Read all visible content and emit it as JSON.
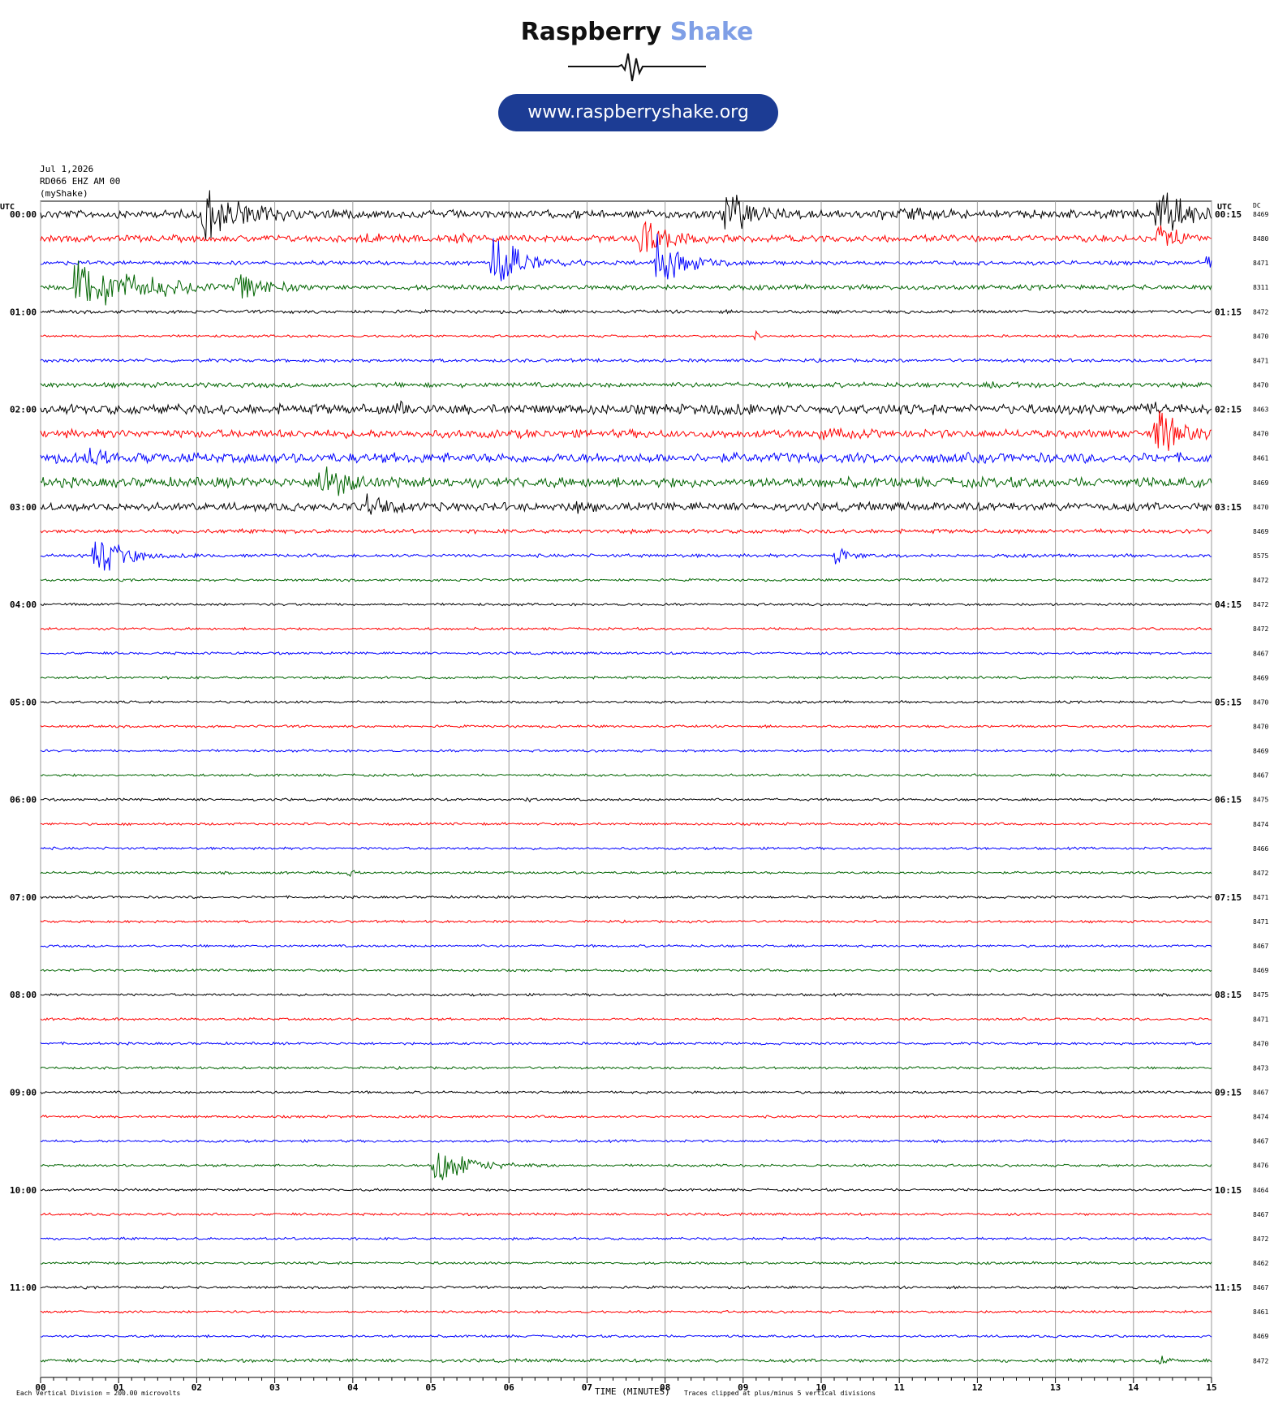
{
  "header": {
    "brand_part1": "Raspberry",
    "brand_part2": "Shake",
    "website": "www.raspberryshake.org",
    "date": "Jul 1,2026",
    "station": "RD066 EHZ AM 00",
    "source": "(myShake)"
  },
  "colors": {
    "trace_cycle": [
      "#000000",
      "#ff0000",
      "#0000ff",
      "#006400"
    ],
    "brand_accent": "#7f9fe6",
    "pill_bg": "#1c3c94"
  },
  "footer": {
    "scale_note": "Each Vertical Division = 200.00 microvolts",
    "xlabel": "TIME (MINUTES)",
    "clip_note": "Traces clipped at plus/minus 5 vertical divisions"
  },
  "chart_data": {
    "type": "line",
    "subtype": "helicorder",
    "xlabel": "TIME (MINUTES)",
    "xlim": [
      0,
      15
    ],
    "x_ticks": [
      "00",
      "01",
      "02",
      "03",
      "04",
      "05",
      "06",
      "07",
      "08",
      "09",
      "10",
      "11",
      "12",
      "13",
      "14",
      "15"
    ],
    "left_axis_title": "UTC",
    "right_axis_title": "UTC",
    "dc_column_title": "DC",
    "grid": true,
    "trace_minutes": 15,
    "rows": [
      {
        "label_left": "00:00",
        "label_right": "00:15",
        "dc": "8469",
        "events": [
          {
            "t": 2.1,
            "amp": 9,
            "dur": 0.9
          },
          {
            "t": 8.75,
            "amp": 7,
            "dur": 0.6
          },
          {
            "t": 14.3,
            "amp": 8,
            "dur": 0.7
          },
          {
            "t": 11.0,
            "amp": 1.5,
            "dur": 0.5
          },
          {
            "t": 10.7,
            "amp": 1.5,
            "dur": 0.2
          }
        ],
        "noise": 1.0
      },
      {
        "label_left": "",
        "label_right": "",
        "dc": "8480",
        "events": [
          {
            "t": 7.7,
            "amp": 7,
            "dur": 0.6
          },
          {
            "t": 14.3,
            "amp": 5,
            "dur": 0.4
          },
          {
            "t": 4.2,
            "amp": 1.2,
            "dur": 0.3
          },
          {
            "t": 5.3,
            "amp": 1.2,
            "dur": 0.4
          }
        ],
        "noise": 0.8
      },
      {
        "label_left": "",
        "label_right": "",
        "dc": "8471",
        "events": [
          {
            "t": 5.8,
            "amp": 7,
            "dur": 0.8
          },
          {
            "t": 7.9,
            "amp": 7,
            "dur": 0.6
          },
          {
            "t": 14.95,
            "amp": 1.8,
            "dur": 0.2
          }
        ],
        "noise": 0.5
      },
      {
        "label_left": "",
        "label_right": "",
        "dc": "8311",
        "events": [
          {
            "t": 0.45,
            "amp": 9,
            "dur": 1.5
          },
          {
            "t": 2.5,
            "amp": 5,
            "dur": 0.6
          }
        ],
        "noise": 0.6
      },
      {
        "label_left": "01:00",
        "label_right": "01:15",
        "dc": "8472",
        "events": [],
        "noise": 0.4
      },
      {
        "label_left": "",
        "label_right": "",
        "dc": "8470",
        "events": [
          {
            "t": 9.15,
            "amp": 1.5,
            "dur": 0.1
          }
        ],
        "noise": 0.3
      },
      {
        "label_left": "",
        "label_right": "",
        "dc": "8471",
        "events": [],
        "noise": 0.4
      },
      {
        "label_left": "",
        "label_right": "",
        "dc": "8470",
        "events": [
          {
            "t": 12.2,
            "amp": 1.0,
            "dur": 0.5
          }
        ],
        "noise": 0.6
      },
      {
        "label_left": "02:00",
        "label_right": "02:15",
        "dc": "8463",
        "events": [
          {
            "t": 14.2,
            "amp": 1.5,
            "dur": 0.4
          },
          {
            "t": 4.6,
            "amp": 1.0,
            "dur": 0.3
          },
          {
            "t": 8.6,
            "amp": 1.0,
            "dur": 0.6
          }
        ],
        "noise": 1.2
      },
      {
        "label_left": "",
        "label_right": "",
        "dc": "8470",
        "events": [
          {
            "t": 14.3,
            "amp": 6,
            "dur": 0.5
          },
          {
            "t": 10.0,
            "amp": 1.5,
            "dur": 0.4
          }
        ],
        "noise": 1.0
      },
      {
        "label_left": "",
        "label_right": "",
        "dc": "8461",
        "events": [
          {
            "t": 0.6,
            "amp": 2,
            "dur": 0.5
          }
        ],
        "noise": 1.2
      },
      {
        "label_left": "",
        "label_right": "",
        "dc": "8469",
        "events": [
          {
            "t": 3.6,
            "amp": 5,
            "dur": 0.6
          }
        ],
        "noise": 1.2
      },
      {
        "label_left": "03:00",
        "label_right": "03:15",
        "dc": "8470",
        "events": [
          {
            "t": 4.2,
            "amp": 4,
            "dur": 0.5
          },
          {
            "t": 6.9,
            "amp": 1.2,
            "dur": 0.3
          }
        ],
        "noise": 1.0
      },
      {
        "label_left": "",
        "label_right": "",
        "dc": "8469",
        "events": [],
        "noise": 0.5
      },
      {
        "label_left": "",
        "label_right": "",
        "dc": "8575",
        "events": [
          {
            "t": 0.7,
            "amp": 6,
            "dur": 0.7
          },
          {
            "t": 10.2,
            "amp": 3,
            "dur": 0.3
          }
        ],
        "noise": 0.4
      },
      {
        "label_left": "",
        "label_right": "",
        "dc": "8472",
        "events": [],
        "noise": 0.3
      },
      {
        "label_left": "04:00",
        "label_right": "04:15",
        "dc": "8472",
        "events": [],
        "noise": 0.3
      },
      {
        "label_left": "",
        "label_right": "",
        "dc": "8472",
        "events": [],
        "noise": 0.3
      },
      {
        "label_left": "",
        "label_right": "",
        "dc": "8467",
        "events": [],
        "noise": 0.3
      },
      {
        "label_left": "",
        "label_right": "",
        "dc": "8469",
        "events": [],
        "noise": 0.3
      },
      {
        "label_left": "05:00",
        "label_right": "05:15",
        "dc": "8470",
        "events": [],
        "noise": 0.3
      },
      {
        "label_left": "",
        "label_right": "",
        "dc": "8470",
        "events": [],
        "noise": 0.3
      },
      {
        "label_left": "",
        "label_right": "",
        "dc": "8469",
        "events": [],
        "noise": 0.3
      },
      {
        "label_left": "",
        "label_right": "",
        "dc": "8467",
        "events": [],
        "noise": 0.3
      },
      {
        "label_left": "06:00",
        "label_right": "06:15",
        "dc": "8475",
        "events": [
          {
            "t": 6.25,
            "amp": 0.8,
            "dur": 0.1
          }
        ],
        "noise": 0.3
      },
      {
        "label_left": "",
        "label_right": "",
        "dc": "8474",
        "events": [],
        "noise": 0.3
      },
      {
        "label_left": "",
        "label_right": "",
        "dc": "8466",
        "events": [],
        "noise": 0.3
      },
      {
        "label_left": "",
        "label_right": "",
        "dc": "8472",
        "events": [
          {
            "t": 3.95,
            "amp": 1.2,
            "dur": 0.1
          }
        ],
        "noise": 0.3
      },
      {
        "label_left": "07:00",
        "label_right": "07:15",
        "dc": "8471",
        "events": [],
        "noise": 0.3
      },
      {
        "label_left": "",
        "label_right": "",
        "dc": "8471",
        "events": [],
        "noise": 0.3
      },
      {
        "label_left": "",
        "label_right": "",
        "dc": "8467",
        "events": [],
        "noise": 0.3
      },
      {
        "label_left": "",
        "label_right": "",
        "dc": "8469",
        "events": [],
        "noise": 0.3
      },
      {
        "label_left": "08:00",
        "label_right": "08:15",
        "dc": "8475",
        "events": [],
        "noise": 0.3
      },
      {
        "label_left": "",
        "label_right": "",
        "dc": "8471",
        "events": [],
        "noise": 0.3
      },
      {
        "label_left": "",
        "label_right": "",
        "dc": "8470",
        "events": [],
        "noise": 0.3
      },
      {
        "label_left": "",
        "label_right": "",
        "dc": "8473",
        "events": [],
        "noise": 0.3
      },
      {
        "label_left": "09:00",
        "label_right": "09:15",
        "dc": "8467",
        "events": [],
        "noise": 0.3
      },
      {
        "label_left": "",
        "label_right": "",
        "dc": "8474",
        "events": [],
        "noise": 0.3
      },
      {
        "label_left": "",
        "label_right": "",
        "dc": "8467",
        "events": [],
        "noise": 0.3
      },
      {
        "label_left": "",
        "label_right": "",
        "dc": "8476",
        "events": [
          {
            "t": 5.05,
            "amp": 6,
            "dur": 0.8
          }
        ],
        "noise": 0.3
      },
      {
        "label_left": "10:00",
        "label_right": "10:15",
        "dc": "8464",
        "events": [],
        "noise": 0.3
      },
      {
        "label_left": "",
        "label_right": "",
        "dc": "8467",
        "events": [],
        "noise": 0.3
      },
      {
        "label_left": "",
        "label_right": "",
        "dc": "8472",
        "events": [],
        "noise": 0.3
      },
      {
        "label_left": "",
        "label_right": "",
        "dc": "8462",
        "events": [],
        "noise": 0.3
      },
      {
        "label_left": "11:00",
        "label_right": "11:15",
        "dc": "8467",
        "events": [],
        "noise": 0.3
      },
      {
        "label_left": "",
        "label_right": "",
        "dc": "8461",
        "events": [],
        "noise": 0.3
      },
      {
        "label_left": "",
        "label_right": "",
        "dc": "8469",
        "events": [],
        "noise": 0.3
      },
      {
        "label_left": "",
        "label_right": "",
        "dc": "8472",
        "events": [
          {
            "t": 14.35,
            "amp": 1.5,
            "dur": 0.2
          }
        ],
        "noise": 0.4
      }
    ]
  }
}
